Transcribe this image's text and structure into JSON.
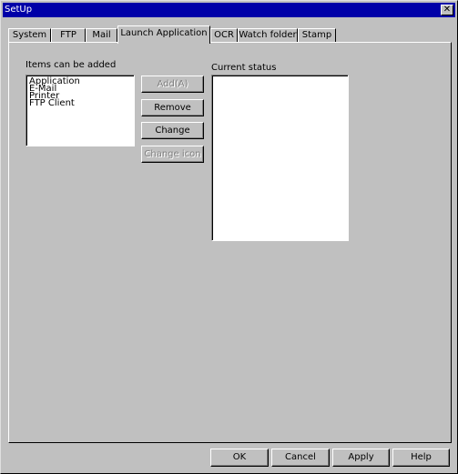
{
  "window": {
    "title": "SetUp",
    "close_glyph": "✕"
  },
  "tabs": [
    {
      "label": "System",
      "active": false
    },
    {
      "label": "FTP",
      "active": false
    },
    {
      "label": "Mail",
      "active": false
    },
    {
      "label": "Launch Application",
      "active": true
    },
    {
      "label": "OCR",
      "active": false
    },
    {
      "label": "Watch folder",
      "active": false
    },
    {
      "label": "Stamp",
      "active": false
    }
  ],
  "launch_application": {
    "items_label": "Items can be added",
    "items": [
      "Application",
      "E-Mail",
      "Printer",
      "FTP Client"
    ],
    "current_status_label": "Current status",
    "current_status_items": [],
    "buttons": {
      "add": {
        "label": "Add(A)",
        "enabled": false
      },
      "remove": {
        "label": "Remove",
        "enabled": true
      },
      "change": {
        "label": "Change",
        "enabled": true
      },
      "change_icon": {
        "label": "Change icon",
        "enabled": false
      }
    }
  },
  "footer": {
    "ok": "OK",
    "cancel": "Cancel",
    "apply": "Apply",
    "help": "Help"
  }
}
